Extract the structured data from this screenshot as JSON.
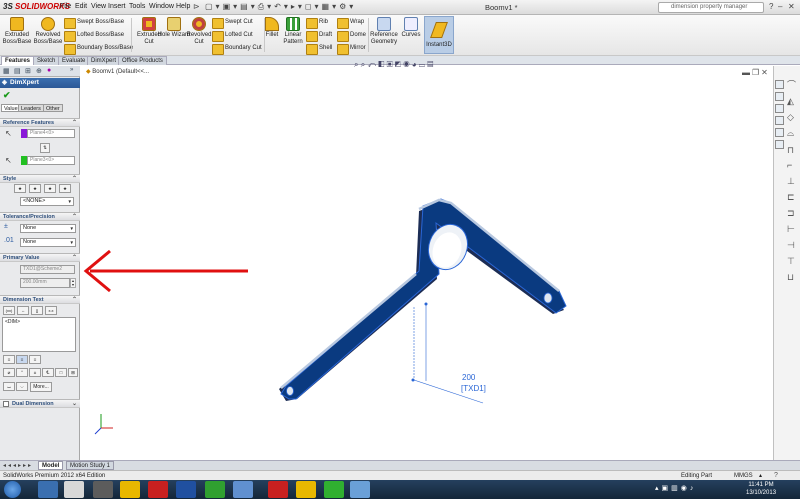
{
  "app": {
    "brand_a": "3S",
    "brand_b": "SOLIDWORKS",
    "doc_title": "Boomv1 *",
    "search_placeholder": "dimension property manager"
  },
  "menu": [
    "File",
    "Edit",
    "View",
    "Insert",
    "Tools",
    "Window",
    "Help"
  ],
  "ribbon": {
    "extruded_boss": "Extruded Boss/Base",
    "revolved_boss": "Revolved Boss/Base",
    "swept_boss": "Swept Boss/Base",
    "lofted_boss": "Lofted Boss/Base",
    "boundary_boss": "Boundary Boss/Base",
    "extruded_cut": "Extruded Cut",
    "hole_wizard": "Hole Wizard",
    "revolved_cut": "Revolved Cut",
    "swept_cut": "Swept Cut",
    "lofted_cut": "Lofted Cut",
    "boundary_cut": "Boundary Cut",
    "fillet": "Fillet",
    "linear_pattern": "Linear Pattern",
    "rib": "Rib",
    "draft": "Draft",
    "shell": "Shell",
    "wrap": "Wrap",
    "dome": "Dome",
    "mirror": "Mirror",
    "reference_geometry": "Reference Geometry",
    "curves": "Curves",
    "instant3d": "Instant3D"
  },
  "tabs": [
    "Features",
    "Sketch",
    "Evaluate",
    "DimXpert",
    "Office Products"
  ],
  "active_tab": "Features",
  "panel": {
    "title": "DimXpert",
    "subtabs": [
      "Value",
      "Leaders",
      "Other"
    ],
    "reference_features": {
      "header": "Reference Features",
      "first": "Plane4<0>",
      "second": "Plane3<0>"
    },
    "style": {
      "header": "Style",
      "value": "<NONE>"
    },
    "tolerance": {
      "header": "Tolerance/Precision",
      "tol_type": "None",
      "precision": "None"
    },
    "primary_value": {
      "header": "Primary Value",
      "name": "TXD1@Scheme2",
      "value": "200.00mm"
    },
    "dimension_text": {
      "header": "Dimension Text",
      "text": "<DIM>",
      "more": "More..."
    },
    "dual_dimension": "Dual Dimension"
  },
  "viewport": {
    "tree_item": "Boomv1  (Default<<..."
  },
  "annotation": {
    "dim_value": "200",
    "dim_name": "[TXD1]"
  },
  "bottom_tabs": [
    "Model",
    "Motion Study 1"
  ],
  "status": {
    "left": "SolidWorks Premium 2012 x64 Edition",
    "mode": "Editing Part",
    "units": "MMGS"
  },
  "clock": {
    "time": "11:41 PM",
    "date": "13/10/2013"
  },
  "colors": {
    "part_blue": "#0a3a80",
    "edge_blue": "#2a66d6",
    "arrow_red": "#e01010",
    "accent": "#2c5896"
  }
}
